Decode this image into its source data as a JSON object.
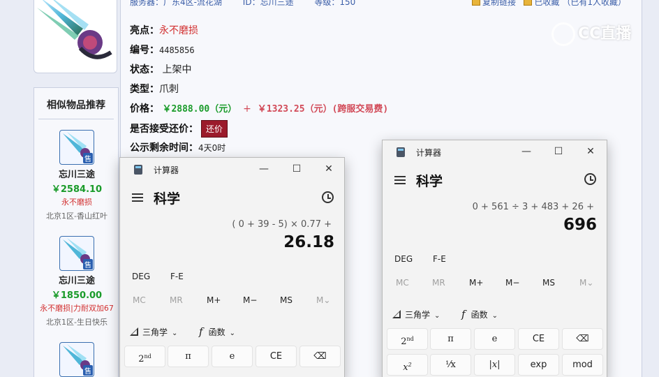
{
  "web": {
    "top_info": {
      "server": "服务器：广东4区-流花湖",
      "id": "ID：忘川三途",
      "level": "等级：150",
      "copy_link": "复制链接",
      "favorited": "已收藏",
      "fav_count": "（已有1人收藏）"
    },
    "details": {
      "highlight_label": "亮点：",
      "highlight_value": "永不磨损",
      "serial_label": "编号：",
      "serial_value": "4485856",
      "status_label": "状态：",
      "status_value": "上架中",
      "type_label": "类型：",
      "type_value": "爪刺",
      "price_label": "价格：",
      "price_value": "￥2888.00（元）",
      "price_plus": "+",
      "price_fee": "￥1323.25（元）(跨服交易费)",
      "offer_label": "是否接受还价：",
      "offer_button": "还价",
      "remaining_label": "公示剩余时间：",
      "remaining_value": "4天0时"
    },
    "watermark": "CC直播",
    "similar": {
      "title": "相似物品推荐",
      "sold_badge": "售",
      "items": [
        {
          "name": "忘川三途",
          "price": "￥2584.10",
          "tag": "永不磨损",
          "server": "北京1区-香山红叶"
        },
        {
          "name": "忘川三途",
          "price": "￥1850.00",
          "tag": "永不磨损|力耐双加67",
          "server": "北京1区-生日快乐"
        }
      ]
    }
  },
  "calc_left": {
    "title": "计算器",
    "mode": "科学",
    "expression": "( 0 + 39 - 5) × 0.77 +",
    "result": "26.18",
    "angle": "DEG",
    "fe": "F-E",
    "memory": [
      "MC",
      "MR",
      "M+",
      "M−",
      "MS",
      "M⌄"
    ],
    "trig": "三角学",
    "func": "函数",
    "keys": [
      "2",
      "π",
      "e",
      "CE",
      "⌫"
    ],
    "sup_nd": "nd"
  },
  "calc_right": {
    "title": "计算器",
    "mode": "科学",
    "expression": "0 + 561 ÷ 3 + 483 + 26 +",
    "result": "696",
    "angle": "DEG",
    "fe": "F-E",
    "memory": [
      "MC",
      "MR",
      "M+",
      "M−",
      "MS",
      "M⌄"
    ],
    "trig": "三角学",
    "func": "函数",
    "keys_row1": [
      "2",
      "π",
      "e",
      "CE",
      "⌫"
    ],
    "keys_row2": [
      "x",
      "¹⁄x",
      "|x|",
      "exp",
      "mod"
    ],
    "sup_nd": "nd",
    "sup_2": "2"
  },
  "window_controls": {
    "minimize": "—",
    "maximize": "☐",
    "close": "✕"
  },
  "colors": {
    "price_green": "#1a9b2a",
    "fee_pink": "#d24a58",
    "highlight_red": "#d23030",
    "offer_button": "#9b1b2b"
  }
}
